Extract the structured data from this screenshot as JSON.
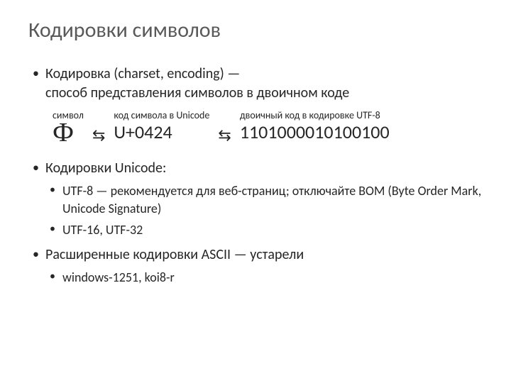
{
  "title": "Кодировки символов",
  "bullets": {
    "b1_line1": "Кодировка (charset, encoding) —",
    "b1_line2": "способ представления символов в двоичном коде",
    "b2": "Кодировки Unicode:",
    "b2_1": "UTF-8 — рекомендуется для веб-страниц; отключайте BOM (Byte Order Mark, Unicode Signature)",
    "b2_2": "UTF-16, UTF-32",
    "b3": "Расширенные кодировки ASCII — устарели",
    "b3_1": "windows-1251, koi8-r"
  },
  "diagram": {
    "symbol_label": "символ",
    "symbol_value": "Ф",
    "arrow": "⇆",
    "code_label": "код символа в Unicode",
    "code_value": "U+0424",
    "bin_label": "двоичный код в кодировке UTF-8",
    "bin_value": "1101000010100100"
  }
}
